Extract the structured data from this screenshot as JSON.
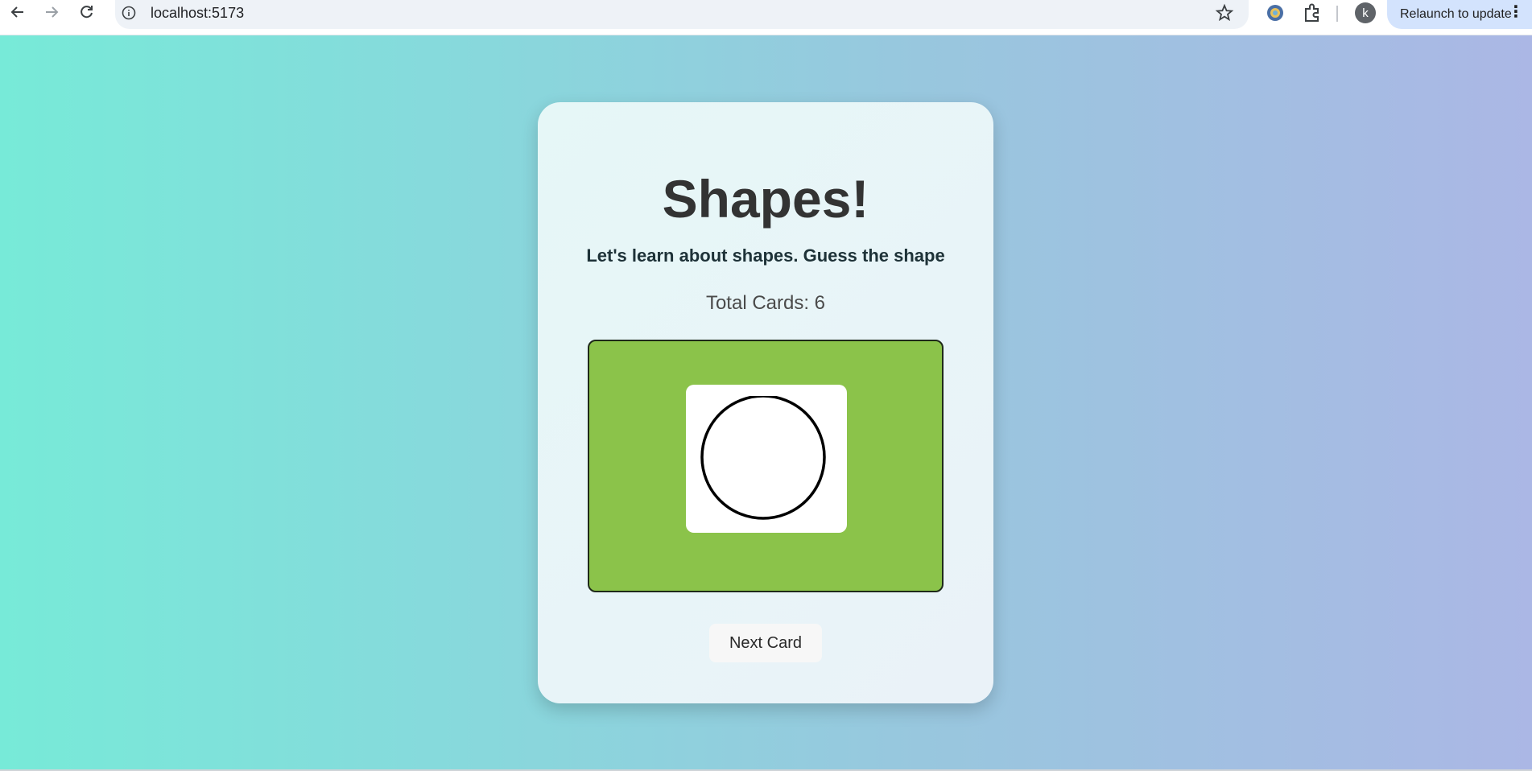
{
  "browser": {
    "url": "localhost:5173",
    "profile_initial": "k",
    "relaunch_label": "Relaunch to update",
    "icons": [
      "back-arrow-icon",
      "forward-arrow-icon",
      "reload-icon",
      "info-icon",
      "star-icon",
      "extension-icon",
      "puzzle-icon",
      "more-vert-icon"
    ]
  },
  "app": {
    "title": "Shapes!",
    "subtitle": "Let's learn about shapes. Guess the shape",
    "total_cards_label": "Total Cards: 6",
    "card": {
      "background_color": "#8bc34a",
      "shape": "circle"
    },
    "next_button_label": "Next Card"
  }
}
